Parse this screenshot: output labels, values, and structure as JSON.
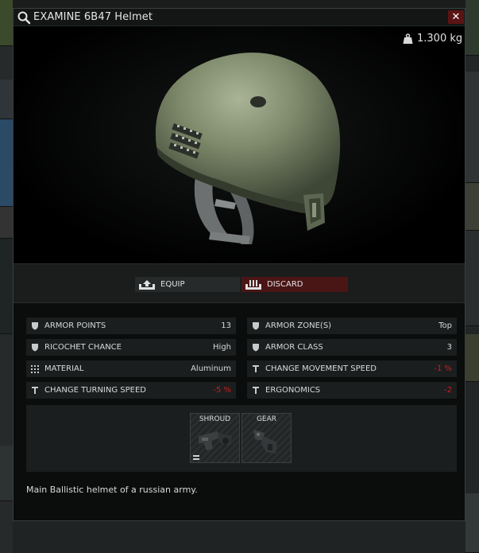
{
  "window": {
    "title": "EXAMINE 6B47 Helmet",
    "close_label": "✕"
  },
  "item": {
    "weight": "1.300 kg",
    "description": "Main Ballistic helmet of a russian army."
  },
  "actions": {
    "equip_label": "EQUIP",
    "discard_label": "DISCARD"
  },
  "stats": [
    {
      "label": "ARMOR POINTS",
      "value": "13",
      "icon": "shield-icon"
    },
    {
      "label": "ARMOR ZONE(S)",
      "value": "Top",
      "icon": "shield-icon"
    },
    {
      "label": "RICOCHET CHANCE",
      "value": "High",
      "icon": "shield-icon"
    },
    {
      "label": "ARMOR CLASS",
      "value": "3",
      "icon": "shield-icon"
    },
    {
      "label": "MATERIAL",
      "value": "Aluminum",
      "icon": "grid-icon"
    },
    {
      "label": "CHANGE MOVEMENT SPEED",
      "value": "-1 %",
      "icon": "speed-icon",
      "negative": true
    },
    {
      "label": "CHANGE TURNING SPEED",
      "value": "-5 %",
      "icon": "speed-icon",
      "negative": true
    },
    {
      "label": "ERGONOMICS",
      "value": "-2",
      "icon": "speed-icon",
      "negative": true
    }
  ],
  "mod_slots": [
    {
      "name": "SHROUD",
      "icon": "shroud-mount-icon"
    },
    {
      "name": "GEAR",
      "icon": "gear-mount-icon"
    }
  ],
  "colors": {
    "negative_value": "#c81e1e",
    "discard_bg": "#4a1515",
    "close_bg": "#5a1414"
  }
}
